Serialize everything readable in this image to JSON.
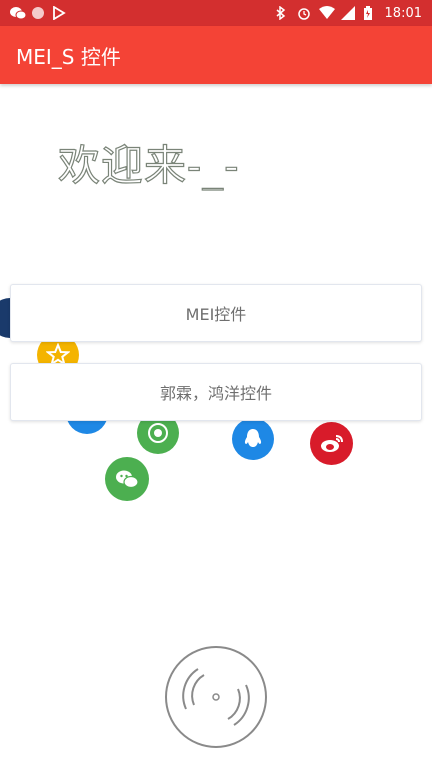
{
  "status_bar": {
    "time": "18:01"
  },
  "app_bar": {
    "title": "MEI_S 控件"
  },
  "welcome_text": "欢迎来-_-",
  "buttons": {
    "mei": "MEI控件",
    "guo": "郭霖，鸿洋控件"
  },
  "colors": {
    "status_bar": "#d32f2f",
    "app_bar": "#f44336",
    "wechat_green": "#4caf50",
    "qq_blue": "#1e88e5",
    "weibo_red": "#d81b2a",
    "star_yellow": "#f4b400",
    "dark_blue": "#1a3a6b"
  },
  "icons": [
    "wechat-icon",
    "dot-icon",
    "play-store-icon",
    "bluetooth-icon",
    "alarm-icon",
    "wifi-icon",
    "signal-icon",
    "battery-icon",
    "star-icon",
    "camera-icon",
    "qq-icon",
    "weibo-icon",
    "share-icon",
    "vinyl-disc-icon"
  ]
}
